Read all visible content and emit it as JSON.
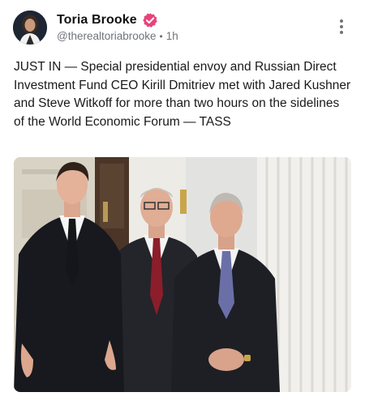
{
  "post": {
    "author": {
      "display_name": "Toria Brooke",
      "handle": "@therealtoriabrooke",
      "verified_icon": "verified-badge-icon",
      "verified_color": "#e8437a"
    },
    "time_ago": "1h",
    "separator": "•",
    "more_icon": "more-vertical-icon",
    "text": "JUST IN — Special presidential envoy and Russian Direct Investment Fund CEO Kirill Dmitriev met with Jared Kushner and Steve Witkoff for more than two hours on the sidelines of the World Economic Forum — TASS",
    "media": {
      "kind": "photo",
      "depicts": "Three men in dark suits standing side by side in a white-paneled room"
    }
  },
  "colors": {
    "text_primary": "#111111",
    "text_secondary": "#6f7479",
    "background": "#ffffff"
  }
}
